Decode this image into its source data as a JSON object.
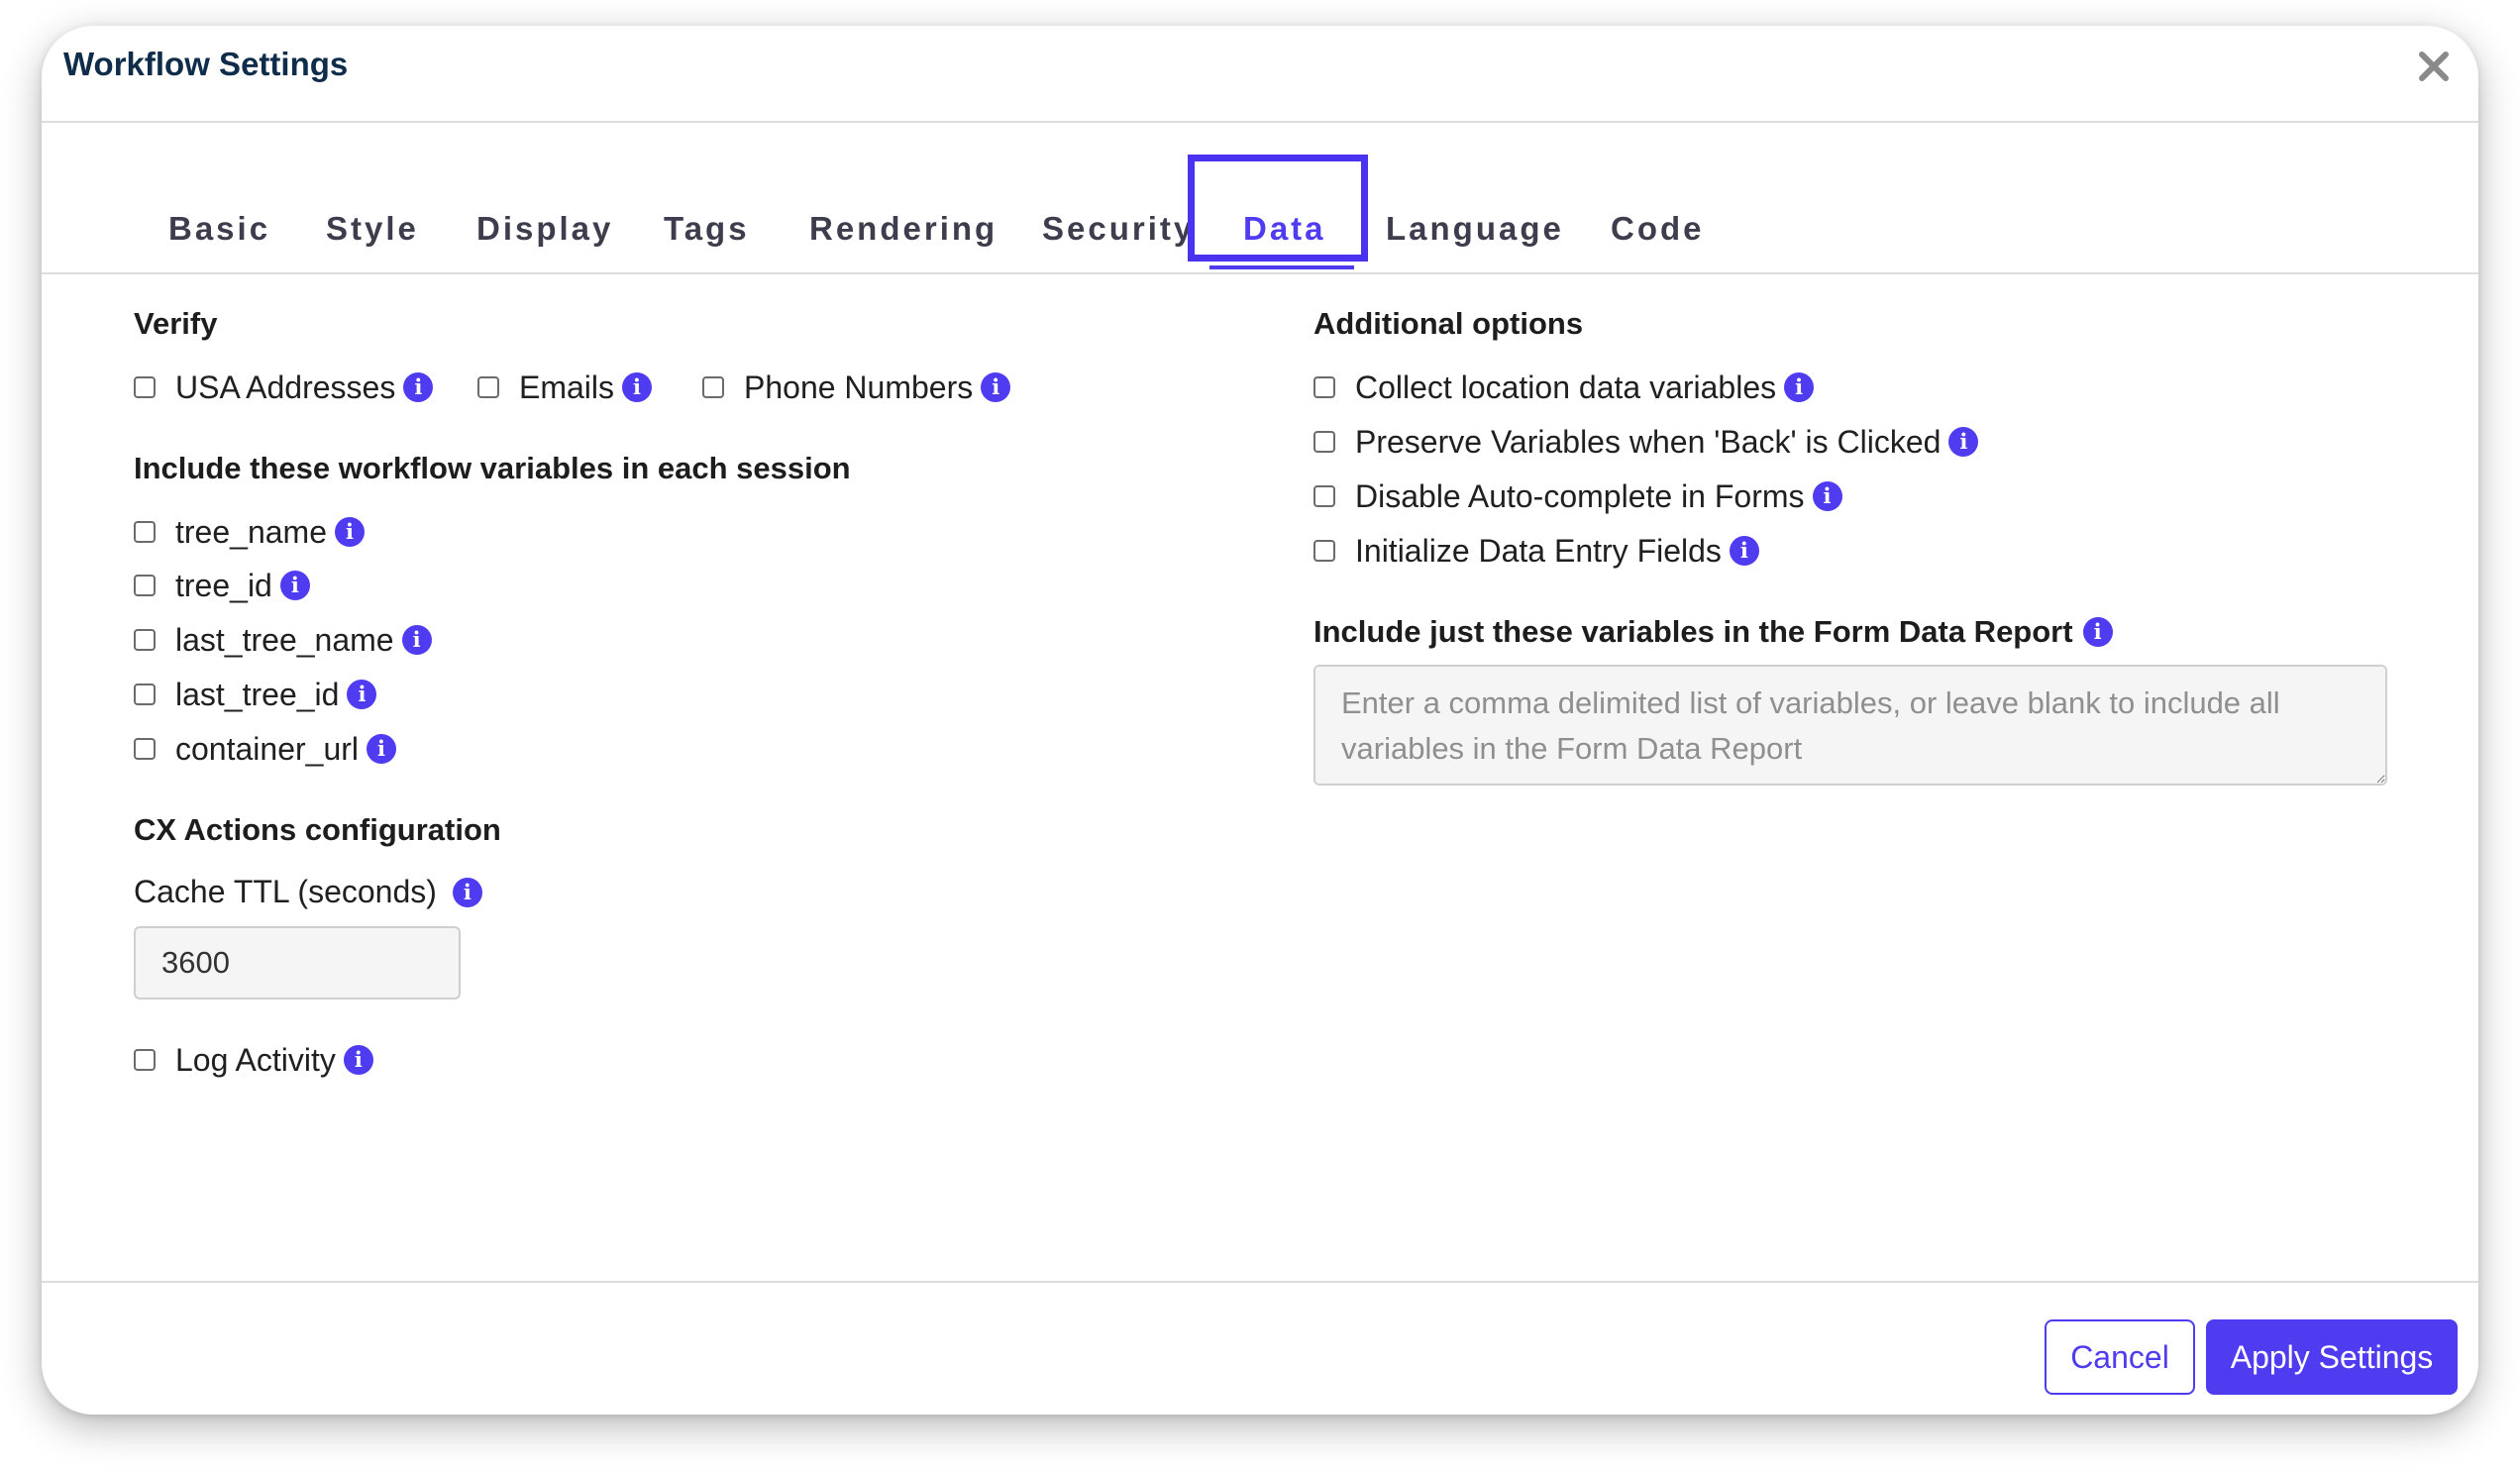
{
  "dialog": {
    "title": "Workflow Settings",
    "close_icon": "close-icon"
  },
  "tabs": [
    {
      "label": "Basic"
    },
    {
      "label": "Style"
    },
    {
      "label": "Display"
    },
    {
      "label": "Tags"
    },
    {
      "label": "Rendering"
    },
    {
      "label": "Security"
    },
    {
      "label": "Data",
      "active": true
    },
    {
      "label": "Language"
    },
    {
      "label": "Code"
    }
  ],
  "verify": {
    "title": "Verify",
    "options": [
      {
        "label": "USA Addresses",
        "checked": false
      },
      {
        "label": "Emails",
        "checked": false
      },
      {
        "label": "Phone Numbers",
        "checked": false
      }
    ]
  },
  "session_vars": {
    "title": "Include these workflow variables in each session",
    "options": [
      {
        "label": "tree_name",
        "checked": false
      },
      {
        "label": "tree_id",
        "checked": false
      },
      {
        "label": "last_tree_name",
        "checked": false
      },
      {
        "label": "last_tree_id",
        "checked": false
      },
      {
        "label": "container_url",
        "checked": false
      }
    ]
  },
  "cx_actions": {
    "title": "CX Actions configuration",
    "cache_ttl_label": "Cache TTL (seconds)",
    "cache_ttl_value": "3600",
    "log_activity_label": "Log Activity",
    "log_activity_checked": false
  },
  "additional": {
    "title": "Additional options",
    "options": [
      {
        "label": "Collect location data variables",
        "checked": false
      },
      {
        "label": "Preserve Variables when 'Back' is Clicked",
        "checked": false
      },
      {
        "label": "Disable Auto-complete in Forms",
        "checked": false
      },
      {
        "label": "Initialize Data Entry Fields",
        "checked": false
      }
    ]
  },
  "report": {
    "title": "Include just these variables in the Form Data Report",
    "placeholder": "Enter a comma delimited list of variables, or leave blank to include all variables in the Form Data Report",
    "value": ""
  },
  "footer": {
    "cancel_label": "Cancel",
    "apply_label": "Apply Settings"
  },
  "colors": {
    "accent": "#4f3bf0",
    "title": "#0f2d4a",
    "focus_ring": "#4a33ef"
  },
  "icons": {
    "info": "info-icon",
    "close": "close-icon"
  }
}
